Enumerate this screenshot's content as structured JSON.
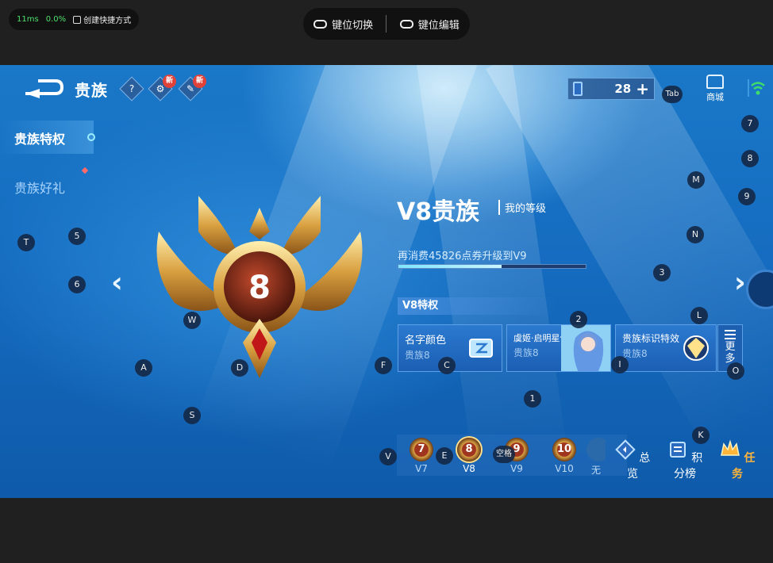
{
  "overlay": {
    "latency": "11ms",
    "loss": "0.0%",
    "create_shortcut": "创建快捷方式",
    "key_switch": "键位切换",
    "key_edit": "键位编辑"
  },
  "header": {
    "title": "贵族",
    "help": "?",
    "new_label": "新",
    "currency_value": "28",
    "shop_label": "商城"
  },
  "sidebar": {
    "items": [
      {
        "label": "贵族特权"
      },
      {
        "label": "贵族好礼"
      }
    ]
  },
  "level": {
    "emblem_number": "8",
    "title": "V8贵族",
    "my_level": "我的等级",
    "upgrade_text": "再消费45826点券升级到V9",
    "progress": 0.55
  },
  "privileges": {
    "header": "V8特权",
    "cards": [
      {
        "name": "名字颜色",
        "sub": "贵族8"
      },
      {
        "name": "虞姬·启明星使",
        "sub": "贵族8"
      },
      {
        "name": "贵族标识特效",
        "sub": "贵族8"
      }
    ],
    "more": "更多"
  },
  "level_strip": [
    {
      "label": "V7",
      "num": "7"
    },
    {
      "label": "V8",
      "num": "8"
    },
    {
      "label": "V9",
      "num": "9"
    },
    {
      "label": "V10",
      "num": "10"
    },
    {
      "label": "无",
      "num": ""
    }
  ],
  "bottom_buttons": {
    "overview": "总览",
    "points": "积分榜",
    "tasks": "任务"
  },
  "keys": {
    "tab": "Tab",
    "k7": "7",
    "k8": "8",
    "k9": "9",
    "m": "M",
    "n": "N",
    "k3": "3",
    "l": "L",
    "k2": "2",
    "i": "I",
    "o": "O",
    "k1": "1",
    "k": "K",
    "t": "T",
    "k5": "5",
    "k6": "6",
    "w": "W",
    "a": "A",
    "d": "D",
    "f": "F",
    "c": "C",
    "s": "S",
    "v": "V",
    "e": "E",
    "space": "空格"
  },
  "colors": {
    "accent": "#1a78c8",
    "task": "#ffb43a",
    "progress": "#7fe4ff"
  }
}
